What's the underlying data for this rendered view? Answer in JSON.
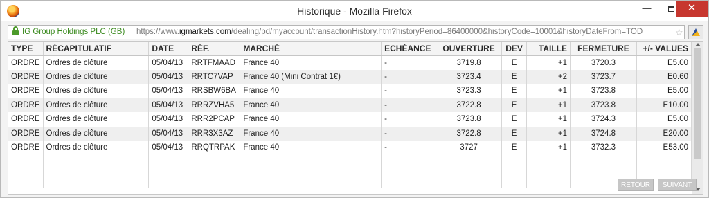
{
  "window": {
    "title": "Historique - Mozilla Firefox",
    "min_label": "—",
    "close_label": "✕"
  },
  "urlbar": {
    "site_identity": "IG Group Holdings PLC (GB)",
    "url_prefix": "https://www.",
    "url_domain": "igmarkets.com",
    "url_rest": "/dealing/pd/myaccount/transactionHistory.htm?historyPeriod=86400000&historyCode=10001&historyDateFrom=TOD",
    "star_label": "☆"
  },
  "table": {
    "headers": [
      "TYPE",
      "RÉCAPITULATIF",
      "DATE",
      "RÉF.",
      "MARCHÉ",
      "ECHÉANCE",
      "OUVERTURE",
      "DEV",
      "TAILLE",
      "FERMETURE",
      "+/- VALUES"
    ],
    "rows": [
      [
        "ORDRE",
        "Ordres de clôture",
        "05/04/13",
        "RRTFMAAD",
        "France 40",
        "-",
        "3719.8",
        "E",
        "+1",
        "3720.3",
        "E5.00"
      ],
      [
        "ORDRE",
        "Ordres de clôture",
        "05/04/13",
        "RRTC7VAP",
        "France 40 (Mini Contrat 1€)",
        "-",
        "3723.4",
        "E",
        "+2",
        "3723.7",
        "E0.60"
      ],
      [
        "ORDRE",
        "Ordres de clôture",
        "05/04/13",
        "RRSBW6BA",
        "France 40",
        "-",
        "3723.3",
        "E",
        "+1",
        "3723.8",
        "E5.00"
      ],
      [
        "ORDRE",
        "Ordres de clôture",
        "05/04/13",
        "RRRZVHA5",
        "France 40",
        "-",
        "3722.8",
        "E",
        "+1",
        "3723.8",
        "E10.00"
      ],
      [
        "ORDRE",
        "Ordres de clôture",
        "05/04/13",
        "RRR2PCAP",
        "France 40",
        "-",
        "3723.8",
        "E",
        "+1",
        "3724.3",
        "E5.00"
      ],
      [
        "ORDRE",
        "Ordres de clôture",
        "05/04/13",
        "RRR3X3AZ",
        "France 40",
        "-",
        "3722.8",
        "E",
        "+1",
        "3724.8",
        "E20.00"
      ],
      [
        "ORDRE",
        "Ordres de clôture",
        "05/04/13",
        "RRQTRPAK",
        "France 40",
        "-",
        "3727",
        "E",
        "+1",
        "3732.3",
        "E53.00"
      ]
    ]
  },
  "pager": {
    "prev_label": "RETOUR",
    "next_label": "SUIVANT"
  }
}
